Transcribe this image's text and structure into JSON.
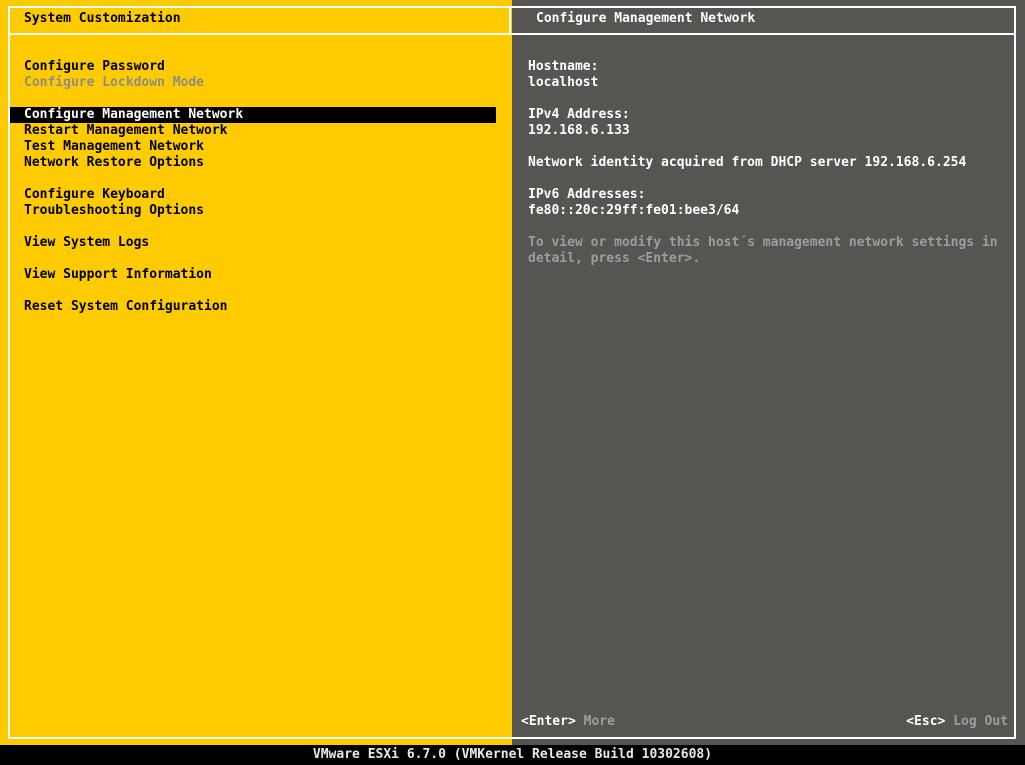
{
  "colors": {
    "yellow": "#FECB00",
    "panel_gray": "#575552",
    "highlight_bg": "#000000",
    "highlight_text": "#FFFFFF",
    "text_dark": "#000000",
    "text_bright": "#FFFFFF",
    "text_muted": "#9D9D9D",
    "text_disabled": "#8E8E80",
    "border": "#FFFFFF",
    "statusbar_bg": "#000000"
  },
  "left_panel": {
    "title": "System Customization",
    "menu_items": [
      {
        "label": "Configure Password",
        "state": "normal",
        "gap_before": false
      },
      {
        "label": "Configure Lockdown Mode",
        "state": "disabled",
        "gap_before": false
      },
      {
        "label": "Configure Management Network",
        "state": "selected",
        "gap_before": true
      },
      {
        "label": "Restart Management Network",
        "state": "normal",
        "gap_before": false
      },
      {
        "label": "Test Management Network",
        "state": "normal",
        "gap_before": false
      },
      {
        "label": "Network Restore Options",
        "state": "normal",
        "gap_before": false
      },
      {
        "label": "Configure Keyboard",
        "state": "normal",
        "gap_before": true
      },
      {
        "label": "Troubleshooting Options",
        "state": "normal",
        "gap_before": false
      },
      {
        "label": "View System Logs",
        "state": "normal",
        "gap_before": true
      },
      {
        "label": "View Support Information",
        "state": "normal",
        "gap_before": true
      },
      {
        "label": "Reset System Configuration",
        "state": "normal",
        "gap_before": true
      }
    ]
  },
  "right_panel": {
    "title": "Configure Management Network",
    "hostname_label": "Hostname:",
    "hostname_value": "localhost",
    "ipv4_label": "IPv4 Address:",
    "ipv4_value": "192.168.6.133",
    "dhcp_notice": "Network identity acquired from DHCP server 192.168.6.254",
    "ipv6_label": "IPv6 Addresses:",
    "ipv6_value": "fe80::20c:29ff:fe01:bee3/64",
    "hint_line1": "To view or modify this host´s management network settings in",
    "hint_line2": "detail, press <Enter>.",
    "footer": {
      "enter_key": "<Enter>",
      "enter_label": "More",
      "esc_key": "<Esc>",
      "esc_label": "Log Out"
    }
  },
  "status_bar": {
    "text": "VMware ESXi 6.7.0 (VMKernel Release Build 10302608)"
  }
}
